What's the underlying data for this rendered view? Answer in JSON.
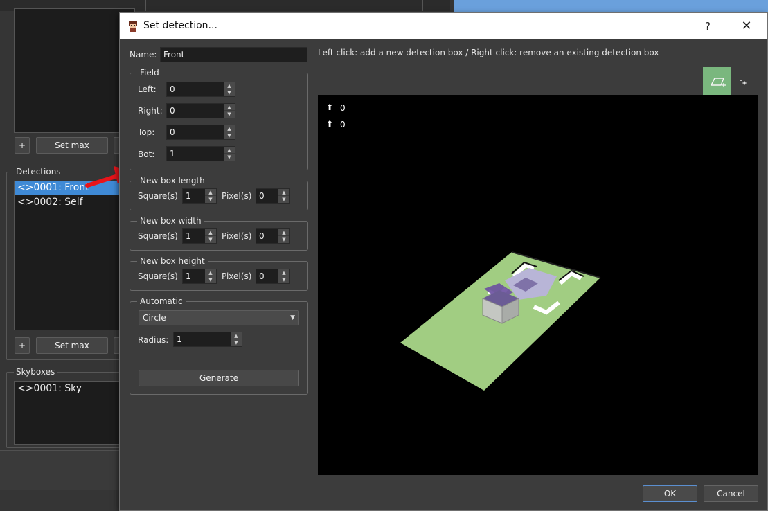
{
  "background": {
    "detections_title": "Detections",
    "detections_items": [
      "<>0001: Front",
      "<>0002: Self"
    ],
    "skyboxes_title": "Skyboxes",
    "skyboxes_items": [
      "<>0001: Sky"
    ],
    "plus_label": "+",
    "setmax_label": "Set max"
  },
  "dialog": {
    "title": "Set detection...",
    "help": "?",
    "close": "✕",
    "hint": "Left click: add a new detection box  / Right click: remove an existing detection box",
    "name_label": "Name:",
    "name_value": "Front",
    "field": {
      "title": "Field",
      "left_label": "Left:",
      "left_value": "0",
      "right_label": "Right:",
      "right_value": "0",
      "top_label": "Top:",
      "top_value": "0",
      "bot_label": "Bot:",
      "bot_value": "1"
    },
    "box_length": {
      "title": "New box length",
      "squares_label": "Square(s)",
      "squares_value": "1",
      "pixels_label": "Pixel(s)",
      "pixels_value": "0"
    },
    "box_width": {
      "title": "New box width",
      "squares_label": "Square(s)",
      "squares_value": "1",
      "pixels_label": "Pixel(s)",
      "pixels_value": "0"
    },
    "box_height": {
      "title": "New box height",
      "squares_label": "Square(s)",
      "squares_value": "1",
      "pixels_label": "Pixel(s)",
      "pixels_value": "0"
    },
    "automatic": {
      "title": "Automatic",
      "shape_value": "Circle",
      "radius_label": "Radius:",
      "radius_value": "1",
      "generate_label": "Generate"
    },
    "viewport": {
      "coord_a": "0",
      "coord_b": "0"
    },
    "ok_label": "OK",
    "cancel_label": "Cancel"
  },
  "colors": {
    "selection": "#3f8ad6",
    "accent_green": "#7ab77e",
    "floor_green": "#a1cd82",
    "arrow_red": "#e8141a"
  }
}
